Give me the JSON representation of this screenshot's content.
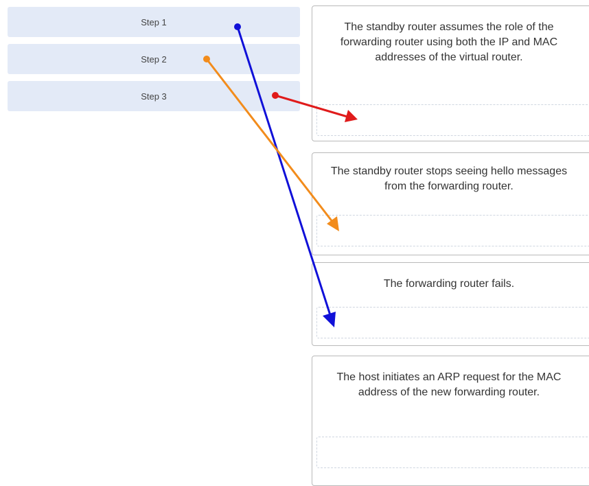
{
  "steps": [
    {
      "label": "Step 1"
    },
    {
      "label": "Step 2"
    },
    {
      "label": "Step 3"
    }
  ],
  "cards": [
    {
      "text": "The standby router assumes the role of the forwarding router using both the IP and MAC addresses of the virtual router."
    },
    {
      "text": "The standby router stops seeing hello messages from the forwarding router."
    },
    {
      "text": "The forwarding router fails."
    },
    {
      "text": "The host initiates an ARP request for the MAC address of the new forwarding router."
    }
  ],
  "arrows": [
    {
      "from": "Step 1",
      "to": "The forwarding router fails.",
      "color": "#1010d8"
    },
    {
      "from": "Step 2",
      "to": "The standby router stops seeing hello messages from the forwarding router.",
      "color": "#f28c1c"
    },
    {
      "from": "Step 3",
      "to": "The standby router assumes the role of the forwarding router using both the IP and MAC addresses of the virtual router.",
      "color": "#e01b1b"
    }
  ]
}
